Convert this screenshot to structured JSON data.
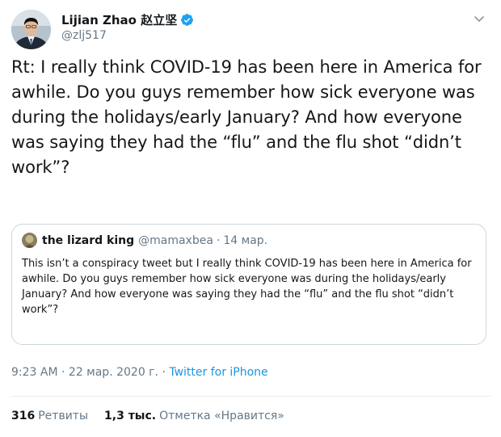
{
  "tweet": {
    "author": {
      "display_name": "Lijian Zhao 赵立坚",
      "handle": "@zlj517",
      "verified": true
    },
    "text": "Rt: I really think COVID-19 has been here in America for awhile. Do you guys remember how sick everyone was during the holidays/early January? And how everyone was saying they had the “flu” and the flu shot “didn’t work”?",
    "quoted": {
      "display_name": "the lizard king",
      "handle": "@mamaxbea",
      "separator": "·",
      "date": "14 мар.",
      "text": "This isn’t a conspiracy tweet but I really think COVID-19 has been here in America for awhile. Do you guys remember how sick everyone was during the holidays/early January? And how everyone was saying they had the “flu” and the flu shot “didn’t work”?"
    },
    "meta": {
      "time": "9:23 AM",
      "separator": "·",
      "date": "22 мар. 2020 г.",
      "source": "Twitter for iPhone"
    },
    "stats": {
      "retweets_count": "316",
      "retweets_label": "Ретвиты",
      "likes_count": "1,3 тыс.",
      "likes_label": "Отметка «Нравится»"
    }
  },
  "icons": {
    "verified": "verified-badge-icon",
    "caret": "chevron-down-icon"
  },
  "colors": {
    "accent": "#1b95e0",
    "text": "#14171a",
    "secondary": "#657786",
    "border": "#ccd6dd"
  }
}
